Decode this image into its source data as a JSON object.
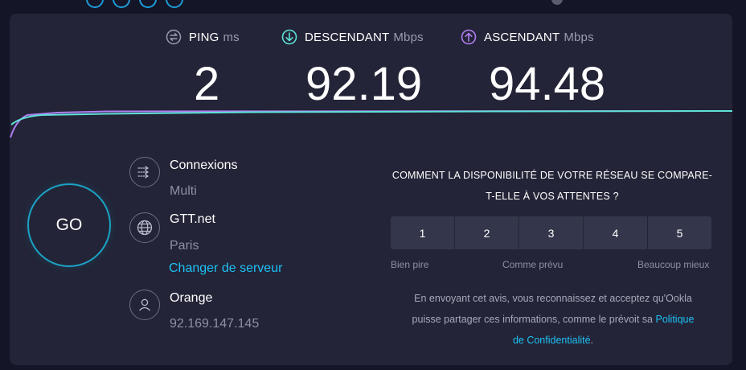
{
  "colors": {
    "background": "#141526",
    "card": "#232437",
    "download_accent": "#5ee1d7",
    "upload_accent": "#b17ef2",
    "link": "#1ec0f5",
    "go_ring": "#1aa3c4"
  },
  "metrics": {
    "ping": {
      "label": "PING",
      "unit": "ms",
      "value": "2",
      "icon": "ping-icon"
    },
    "download": {
      "label": "DESCENDANT",
      "unit": "Mbps",
      "value": "92.19",
      "icon": "download-arrow-icon"
    },
    "upload": {
      "label": "ASCENDANT",
      "unit": "Mbps",
      "value": "94.48",
      "icon": "upload-arrow-icon"
    }
  },
  "go_button": {
    "label": "GO"
  },
  "connection": {
    "title": "Connexions",
    "mode": "Multi",
    "icon": "connections-icon"
  },
  "server": {
    "host": "GTT.net",
    "city": "Paris",
    "change_link": "Changer de serveur",
    "icon": "globe-icon"
  },
  "provider": {
    "name": "Orange",
    "ip": "92.169.147.145",
    "icon": "user-icon"
  },
  "survey": {
    "question_line1": "COMMENT LA DISPONIBILITÉ DE VOTRE RÉSEAU SE COMPARE-",
    "question_line2": "T-ELLE À VOS ATTENTES ?",
    "options": [
      "1",
      "2",
      "3",
      "4",
      "5"
    ],
    "scale_low": "Bien pire",
    "scale_mid": "Comme prévu",
    "scale_high": "Beaucoup mieux",
    "disclaimer_line1": "En envoyant cet avis, vous reconnaissez et acceptez qu'Ookla",
    "disclaimer_line2": "puisse partager ces informations, comme le prévoit sa",
    "privacy_link_part1": "Politique",
    "privacy_link_part2": "de Confidentialité",
    "disclaimer_end": "."
  }
}
